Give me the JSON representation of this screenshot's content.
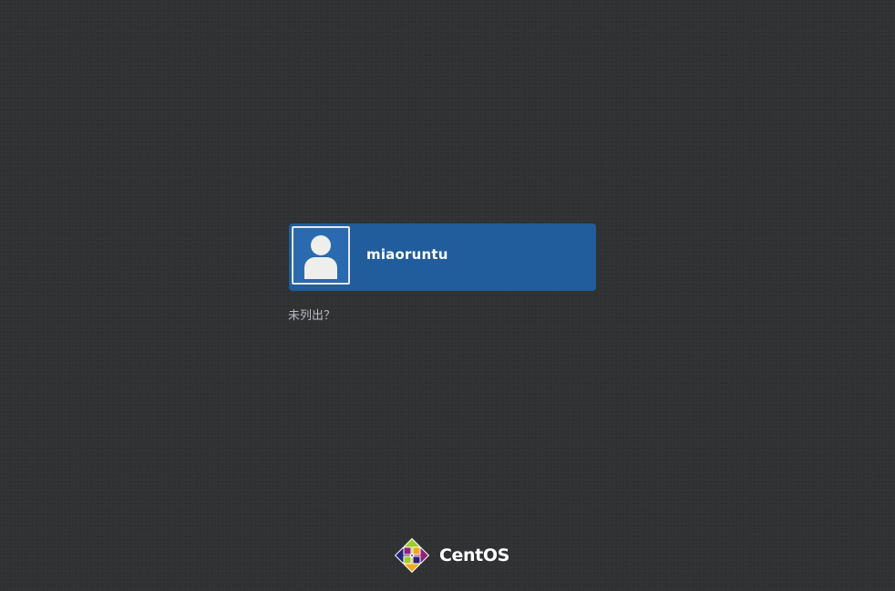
{
  "login": {
    "users": [
      {
        "name": "miaoruntu",
        "avatar_icon": "default-user-icon",
        "selected": true
      }
    ],
    "not_listed_label": "未列出？"
  },
  "branding": {
    "logo_icon": "centos-logo-icon",
    "name": "CentOS"
  },
  "colors": {
    "background": "#2f3133",
    "selected_user_bg": "#215d9c",
    "not_listed_text": "#b8bcbf",
    "logo_green": "#9ccd2a",
    "logo_orange": "#efa724",
    "logo_blue": "#262577",
    "logo_purple": "#932279"
  }
}
